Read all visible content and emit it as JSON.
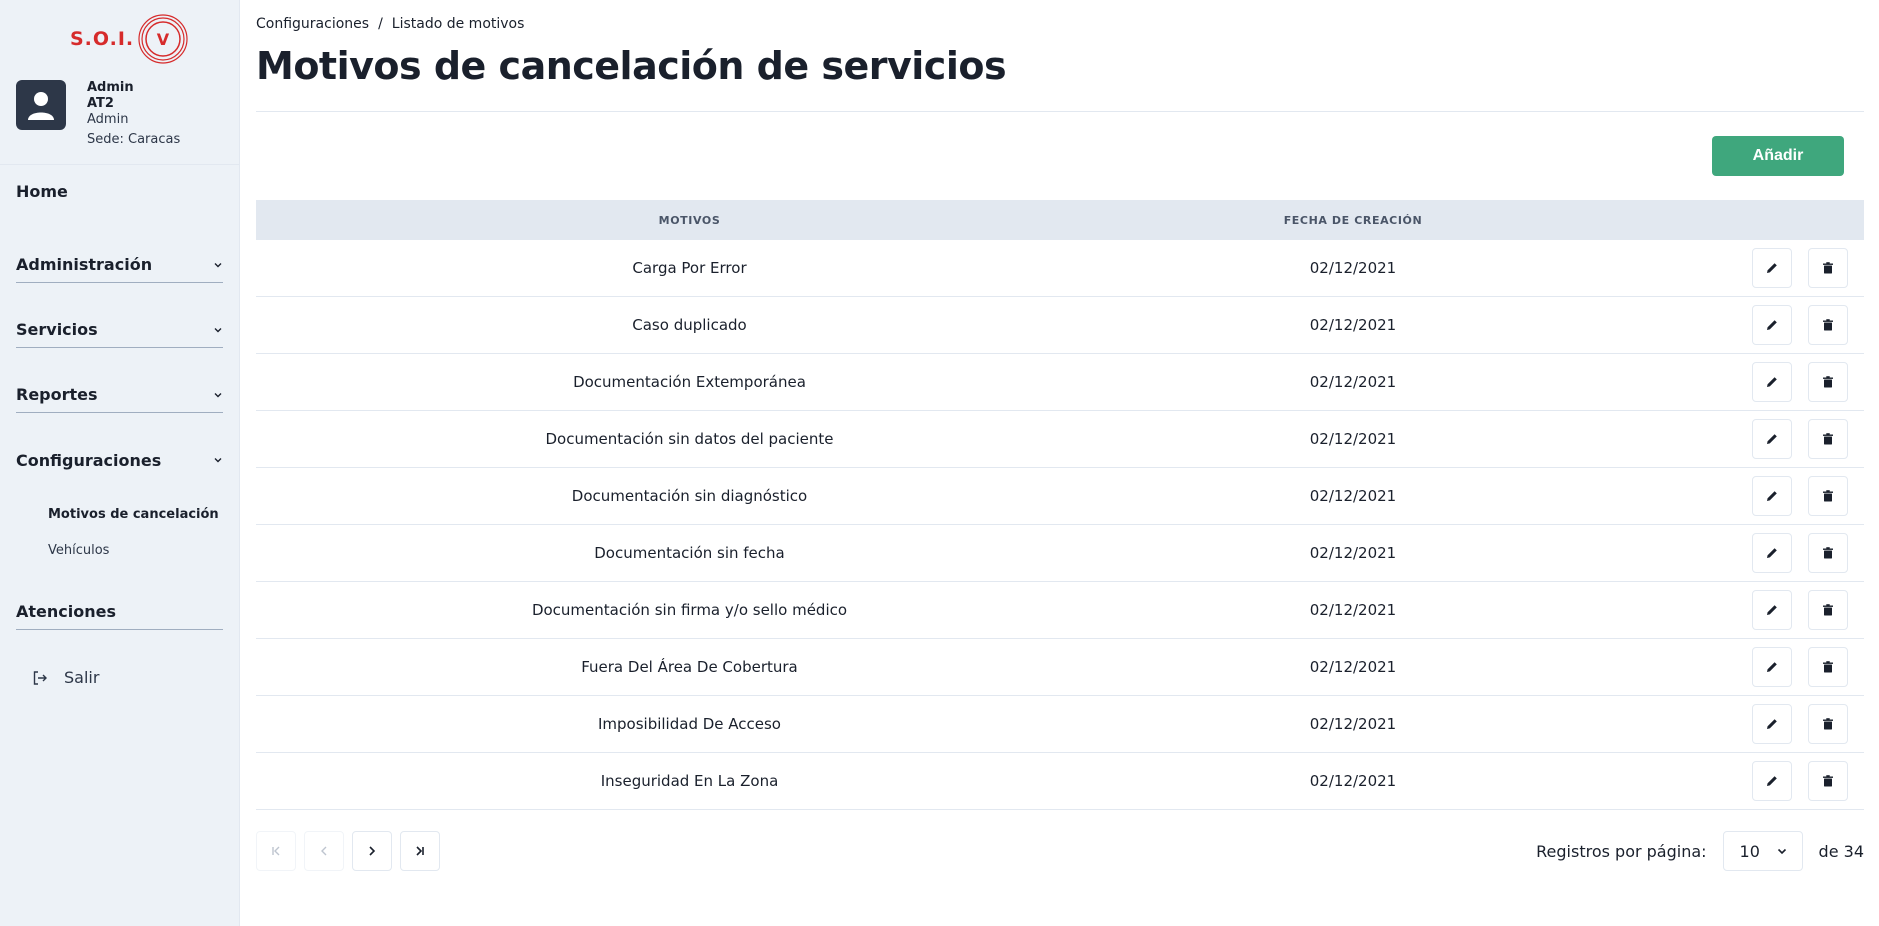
{
  "sidebar": {
    "logo": {
      "text": "S.O.I.",
      "seal_letter": "V"
    },
    "user": {
      "name": "Admin",
      "code": "AT2",
      "role": "Admin",
      "sede": "Sede: Caracas"
    },
    "home": "Home",
    "groups": [
      {
        "label": "Administración"
      },
      {
        "label": "Servicios"
      },
      {
        "label": "Reportes"
      },
      {
        "label": "Configuraciones"
      }
    ],
    "sub_items": [
      {
        "label": "Motivos de cancelación"
      },
      {
        "label": "Vehículos"
      }
    ],
    "atenciones": "Atenciones",
    "logout": "Salir"
  },
  "breadcrumb": {
    "parent": "Configuraciones",
    "separator": "/",
    "current": "Listado de motivos"
  },
  "page_title": "Motivos de cancelación de servicios",
  "add_button": "Añadir",
  "table": {
    "headers": {
      "motivo": "MOTIVOS",
      "fecha": "FECHA DE CREACIÓN"
    },
    "rows": [
      {
        "motivo": "Carga Por Error",
        "fecha": "02/12/2021"
      },
      {
        "motivo": "Caso duplicado",
        "fecha": "02/12/2021"
      },
      {
        "motivo": "Documentación Extemporánea",
        "fecha": "02/12/2021"
      },
      {
        "motivo": "Documentación sin datos del paciente",
        "fecha": "02/12/2021"
      },
      {
        "motivo": "Documentación sin diagnóstico",
        "fecha": "02/12/2021"
      },
      {
        "motivo": "Documentación sin fecha",
        "fecha": "02/12/2021"
      },
      {
        "motivo": "Documentación sin firma y/o sello médico",
        "fecha": "02/12/2021"
      },
      {
        "motivo": "Fuera Del Área De Cobertura",
        "fecha": "02/12/2021"
      },
      {
        "motivo": "Imposibilidad De Acceso",
        "fecha": "02/12/2021"
      },
      {
        "motivo": "Inseguridad En La Zona",
        "fecha": "02/12/2021"
      }
    ]
  },
  "pagination": {
    "per_page_label": "Registros por página:",
    "per_page_value": "10",
    "total_label": "de 34"
  },
  "colors": {
    "accent": "#3fa77d",
    "brand_red": "#d62b2b",
    "sidebar_bg": "#edf2f7",
    "header_bg": "#e2e8f0"
  }
}
